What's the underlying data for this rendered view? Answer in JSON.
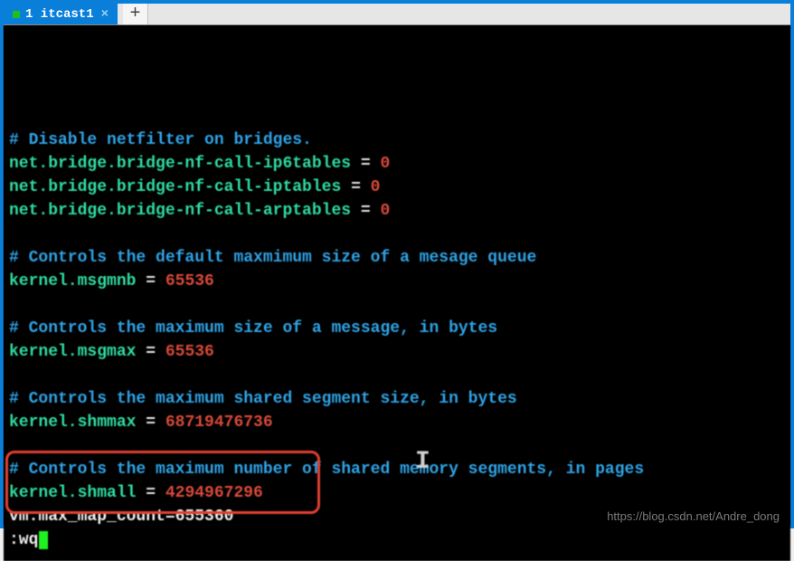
{
  "tabbar": {
    "active_tab_label": "1 itcast1",
    "close_glyph": "×",
    "newtab_glyph": "+"
  },
  "terminal": {
    "lines": [
      {
        "segments": [
          {
            "cls": "comment",
            "t": "# Disable netfilter on bridges."
          }
        ]
      },
      {
        "segments": [
          {
            "cls": "key",
            "t": "net.bridge.bridge-nf-call-ip6tables"
          },
          {
            "cls": "eq",
            "t": " = "
          },
          {
            "cls": "num",
            "t": "0"
          }
        ]
      },
      {
        "segments": [
          {
            "cls": "key",
            "t": "net.bridge.bridge-nf-call-iptables"
          },
          {
            "cls": "eq",
            "t": " = "
          },
          {
            "cls": "num",
            "t": "0"
          }
        ]
      },
      {
        "segments": [
          {
            "cls": "key",
            "t": "net.bridge.bridge-nf-call-arptables"
          },
          {
            "cls": "eq",
            "t": " = "
          },
          {
            "cls": "num",
            "t": "0"
          }
        ]
      },
      {
        "segments": [
          {
            "cls": "plain",
            "t": " "
          }
        ]
      },
      {
        "segments": [
          {
            "cls": "comment",
            "t": "# Controls the default maxmimum size of a mesage queue"
          }
        ]
      },
      {
        "segments": [
          {
            "cls": "key",
            "t": "kernel.msgmnb"
          },
          {
            "cls": "eq",
            "t": " = "
          },
          {
            "cls": "num",
            "t": "65536"
          }
        ]
      },
      {
        "segments": [
          {
            "cls": "plain",
            "t": " "
          }
        ]
      },
      {
        "segments": [
          {
            "cls": "comment",
            "t": "# Controls the maximum size of a message, in bytes"
          }
        ]
      },
      {
        "segments": [
          {
            "cls": "key",
            "t": "kernel.msgmax"
          },
          {
            "cls": "eq",
            "t": " = "
          },
          {
            "cls": "num",
            "t": "65536"
          }
        ]
      },
      {
        "segments": [
          {
            "cls": "plain",
            "t": " "
          }
        ]
      },
      {
        "segments": [
          {
            "cls": "comment",
            "t": "# Controls the maximum shared segment size, in bytes"
          }
        ]
      },
      {
        "segments": [
          {
            "cls": "key",
            "t": "kernel.shmmax"
          },
          {
            "cls": "eq",
            "t": " = "
          },
          {
            "cls": "num",
            "t": "68719476736"
          }
        ]
      },
      {
        "segments": [
          {
            "cls": "plain",
            "t": " "
          }
        ]
      },
      {
        "segments": [
          {
            "cls": "comment",
            "t": "# Controls the maximum number of shared memory segments, in pages"
          }
        ]
      },
      {
        "segments": [
          {
            "cls": "key",
            "t": "kernel.shmall"
          },
          {
            "cls": "eq",
            "t": " = "
          },
          {
            "cls": "num",
            "t": "4294967296"
          }
        ]
      },
      {
        "segments": [
          {
            "cls": "plain",
            "t": "vm.max_map_count=655360"
          }
        ]
      },
      {
        "segments": [
          {
            "cls": "plain",
            "t": ":wq"
          }
        ],
        "cursor": true
      }
    ]
  },
  "watermark": "https://blog.csdn.net/Andre_dong"
}
